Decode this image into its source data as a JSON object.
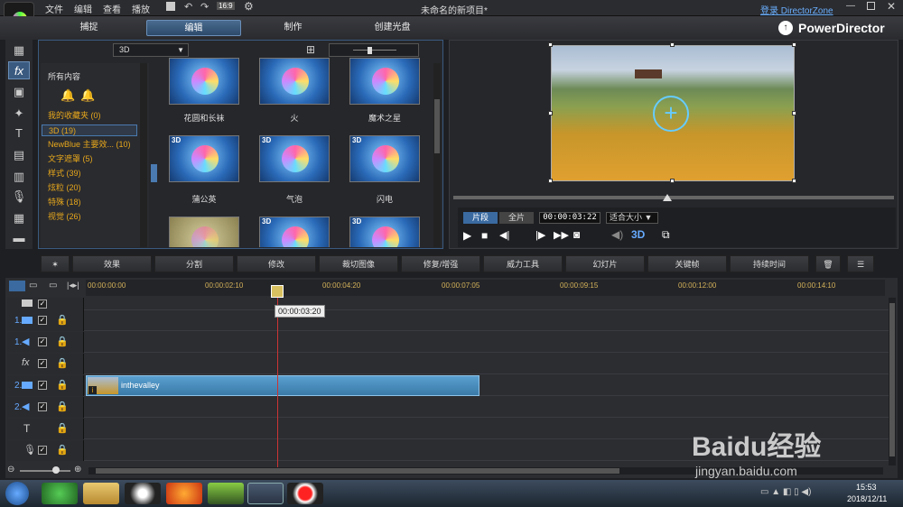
{
  "menu": [
    "文件",
    "编辑",
    "查看",
    "播放"
  ],
  "window_title": "未命名的新项目*",
  "zoom_label": "16:9",
  "login_link": "登录 DirectorZone",
  "brand": "PowerDirector",
  "tabs": [
    "捕捉",
    "编辑",
    "制作",
    "创建光盘"
  ],
  "library": {
    "dropdown": "3D",
    "all_content": "所有内容",
    "categories": [
      "我的收藏夹 (0)",
      "3D (19)",
      "NewBlue 主要效... (10)",
      "文字遮罩 (5)",
      "样式 (39)",
      "炫粒 (20)",
      "特殊 (18)",
      "视觉 (26)"
    ],
    "thumb_badge": "3D",
    "row_labels": [
      "花圆和长袜",
      "火",
      "魔术之星",
      "蒲公英",
      "气泡",
      "闪电"
    ]
  },
  "preview": {
    "mode_clip": "片段",
    "mode_full": "全片",
    "timecode": "00:00:03:22",
    "fit": "适合大小",
    "mode3d": "3D"
  },
  "tools": [
    "效果",
    "分割",
    "修改",
    "裁切图像",
    "修复/增强",
    "威力工具",
    "幻灯片",
    "关键帧",
    "持续时间"
  ],
  "timeline": {
    "ticks": [
      "00:00:00:00",
      "00:00:02:10",
      "00:00:04:20",
      "00:00:07:05",
      "00:00:09:15",
      "00:00:12:00",
      "00:00:14:10"
    ],
    "playhead_time": "00:00:03:20",
    "track_labels": [
      "1.",
      "1.",
      "",
      "2.",
      "2.",
      "",
      ""
    ],
    "clip_name": "inthevalley"
  },
  "taskbar": {
    "time": "15:53",
    "date": "2018/12/11"
  },
  "watermark": "Baidu经验",
  "watermark_url": "jingyan.baidu.com"
}
